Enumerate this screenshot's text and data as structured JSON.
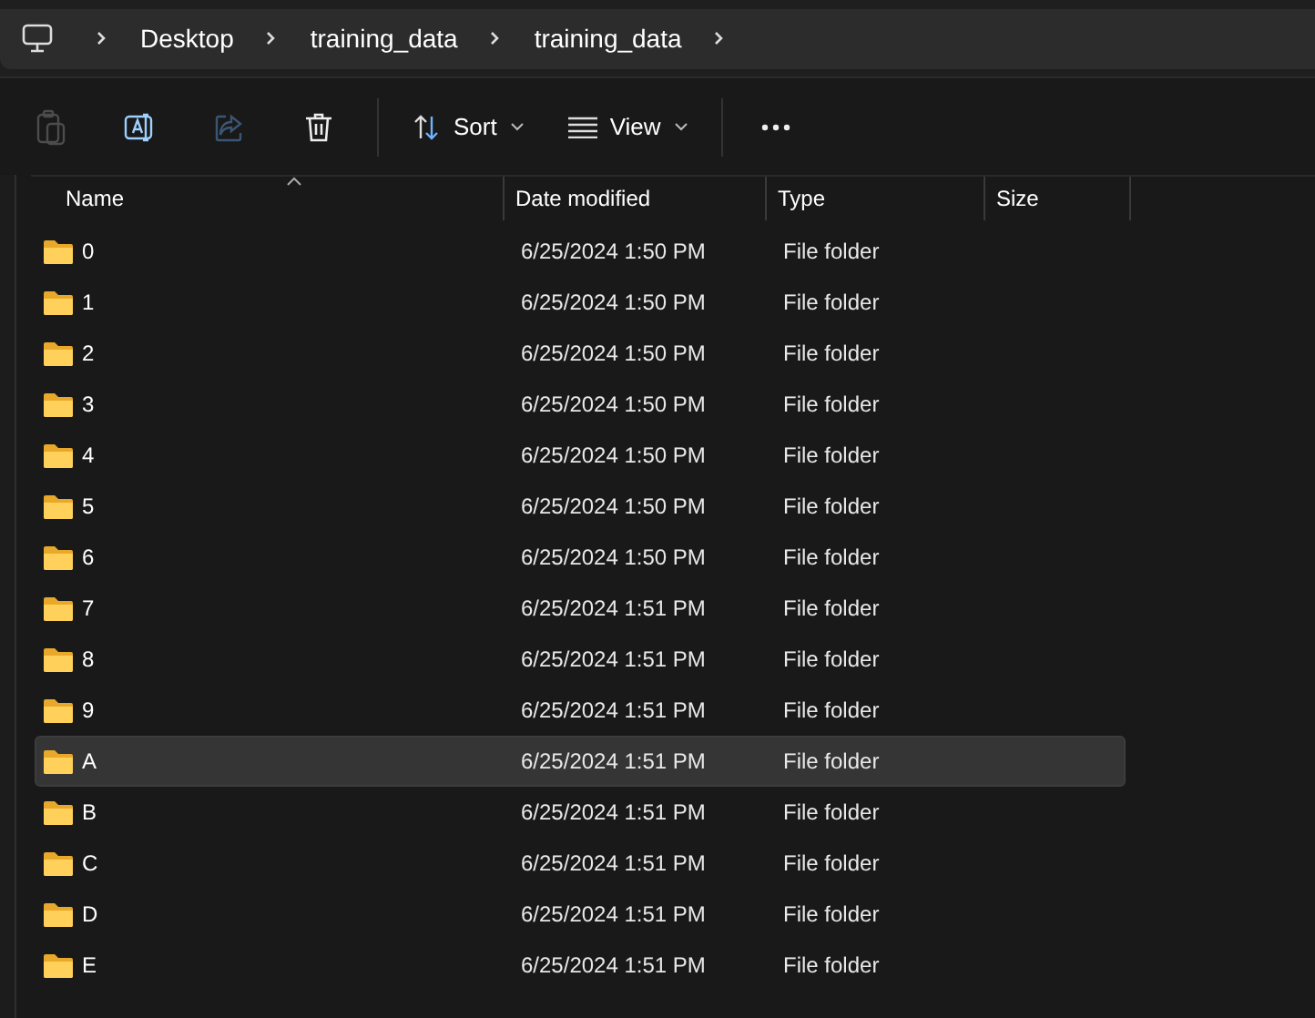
{
  "breadcrumb": {
    "items": [
      "Desktop",
      "training_data",
      "training_data"
    ]
  },
  "toolbar": {
    "actions": [
      {
        "kind": "paste",
        "disabled": true
      },
      {
        "kind": "rename",
        "disabled": false
      },
      {
        "kind": "share",
        "disabled": true
      },
      {
        "kind": "delete",
        "disabled": false
      }
    ],
    "sort": "Sort",
    "view": "View"
  },
  "table": {
    "columns": [
      "Name",
      "Date modified",
      "Type",
      "Size"
    ],
    "rows": [
      {
        "name": "0",
        "date": "6/25/2024 1:50 PM",
        "type": "File folder",
        "selected": false
      },
      {
        "name": "1",
        "date": "6/25/2024 1:50 PM",
        "type": "File folder",
        "selected": false
      },
      {
        "name": "2",
        "date": "6/25/2024 1:50 PM",
        "type": "File folder",
        "selected": false
      },
      {
        "name": "3",
        "date": "6/25/2024 1:50 PM",
        "type": "File folder",
        "selected": false
      },
      {
        "name": "4",
        "date": "6/25/2024 1:50 PM",
        "type": "File folder",
        "selected": false
      },
      {
        "name": "5",
        "date": "6/25/2024 1:50 PM",
        "type": "File folder",
        "selected": false
      },
      {
        "name": "6",
        "date": "6/25/2024 1:50 PM",
        "type": "File folder",
        "selected": false
      },
      {
        "name": "7",
        "date": "6/25/2024 1:51 PM",
        "type": "File folder",
        "selected": false
      },
      {
        "name": "8",
        "date": "6/25/2024 1:51 PM",
        "type": "File folder",
        "selected": false
      },
      {
        "name": "9",
        "date": "6/25/2024 1:51 PM",
        "type": "File folder",
        "selected": false
      },
      {
        "name": "A",
        "date": "6/25/2024 1:51 PM",
        "type": "File folder",
        "selected": true
      },
      {
        "name": "B",
        "date": "6/25/2024 1:51 PM",
        "type": "File folder",
        "selected": false
      },
      {
        "name": "C",
        "date": "6/25/2024 1:51 PM",
        "type": "File folder",
        "selected": false
      },
      {
        "name": "D",
        "date": "6/25/2024 1:51 PM",
        "type": "File folder",
        "selected": false
      },
      {
        "name": "E",
        "date": "6/25/2024 1:51 PM",
        "type": "File folder",
        "selected": false
      }
    ]
  }
}
